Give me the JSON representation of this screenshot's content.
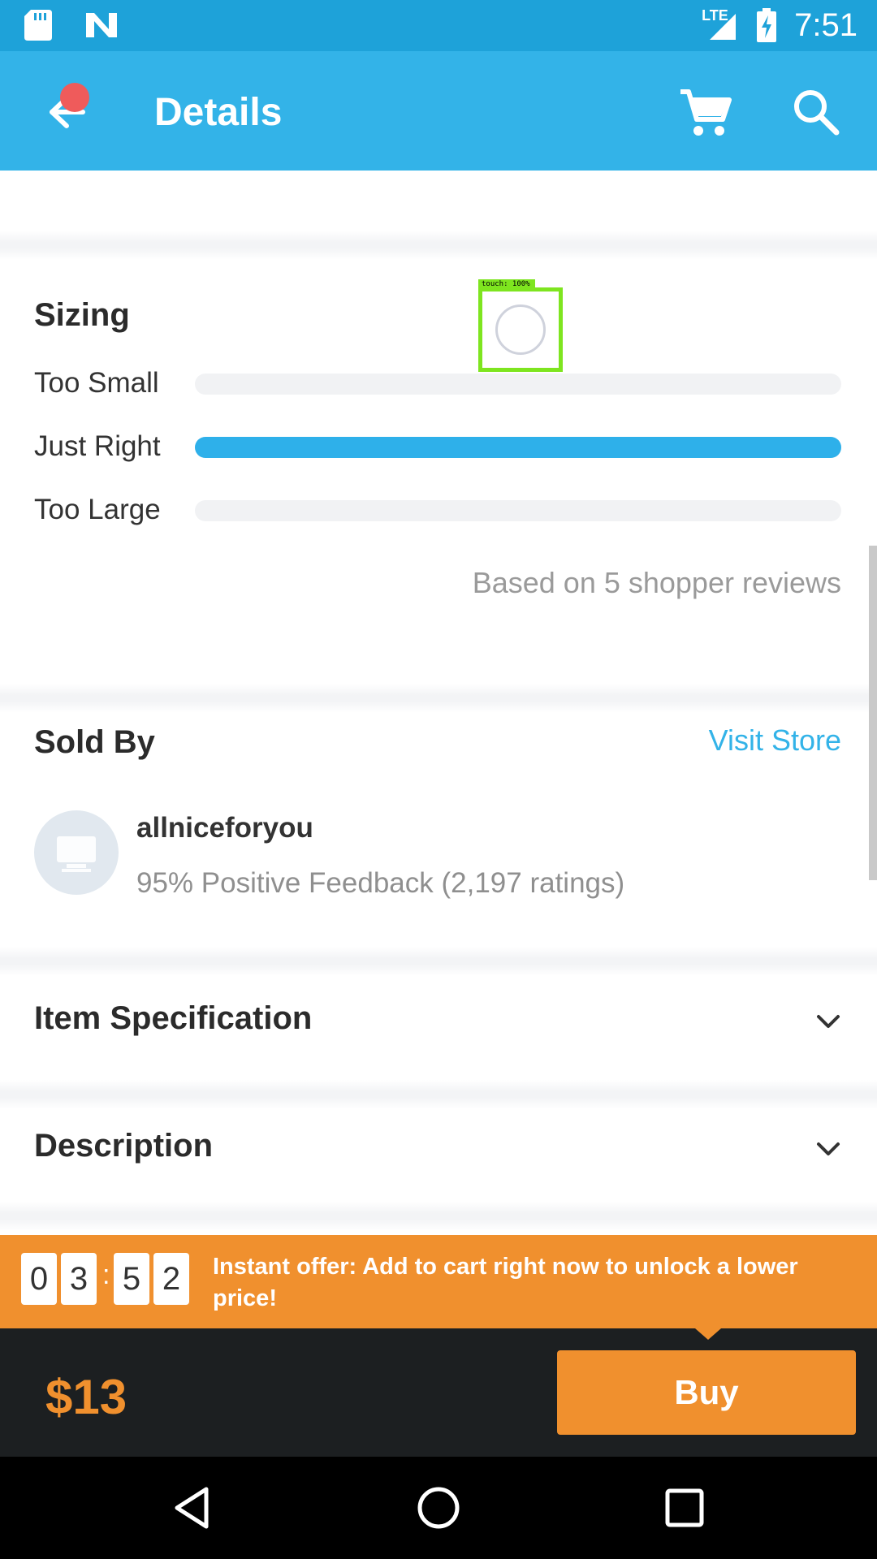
{
  "status_bar": {
    "time": "7:51",
    "network": "LTE",
    "icons": [
      "sd-card-icon",
      "n-notification-icon",
      "lte-signal-icon",
      "battery-charging-icon"
    ]
  },
  "app_bar": {
    "title": "Details",
    "icons": [
      "back-arrow-icon",
      "cart-icon",
      "search-icon"
    ],
    "notification_color": "#ef5b5b"
  },
  "sizing": {
    "heading": "Sizing",
    "rows": [
      {
        "label": "Too Small",
        "fraction": 0
      },
      {
        "label": "Just Right",
        "fraction": 1
      },
      {
        "label": "Too Large",
        "fraction": 0
      }
    ],
    "note": "Based on 5 shopper reviews"
  },
  "sold_by": {
    "heading": "Sold By",
    "visit_store": "Visit Store",
    "store_name": "allniceforyou",
    "feedback": "95% Positive Feedback (2,197 ratings)"
  },
  "sections": {
    "item_specification": "Item Specification",
    "description": "Description"
  },
  "touch_indicator": {
    "label": "touch: 100%"
  },
  "offer": {
    "digits": [
      "0",
      "3",
      "5",
      "2"
    ],
    "separator": ":",
    "text": "Instant offer: Add to cart right now to unlock a lower price!"
  },
  "purchase": {
    "price": "$13",
    "buy_label": "Buy"
  },
  "colors": {
    "primary": "#33b3e8",
    "accent": "#f0902e",
    "dark": "#1c1f21"
  }
}
